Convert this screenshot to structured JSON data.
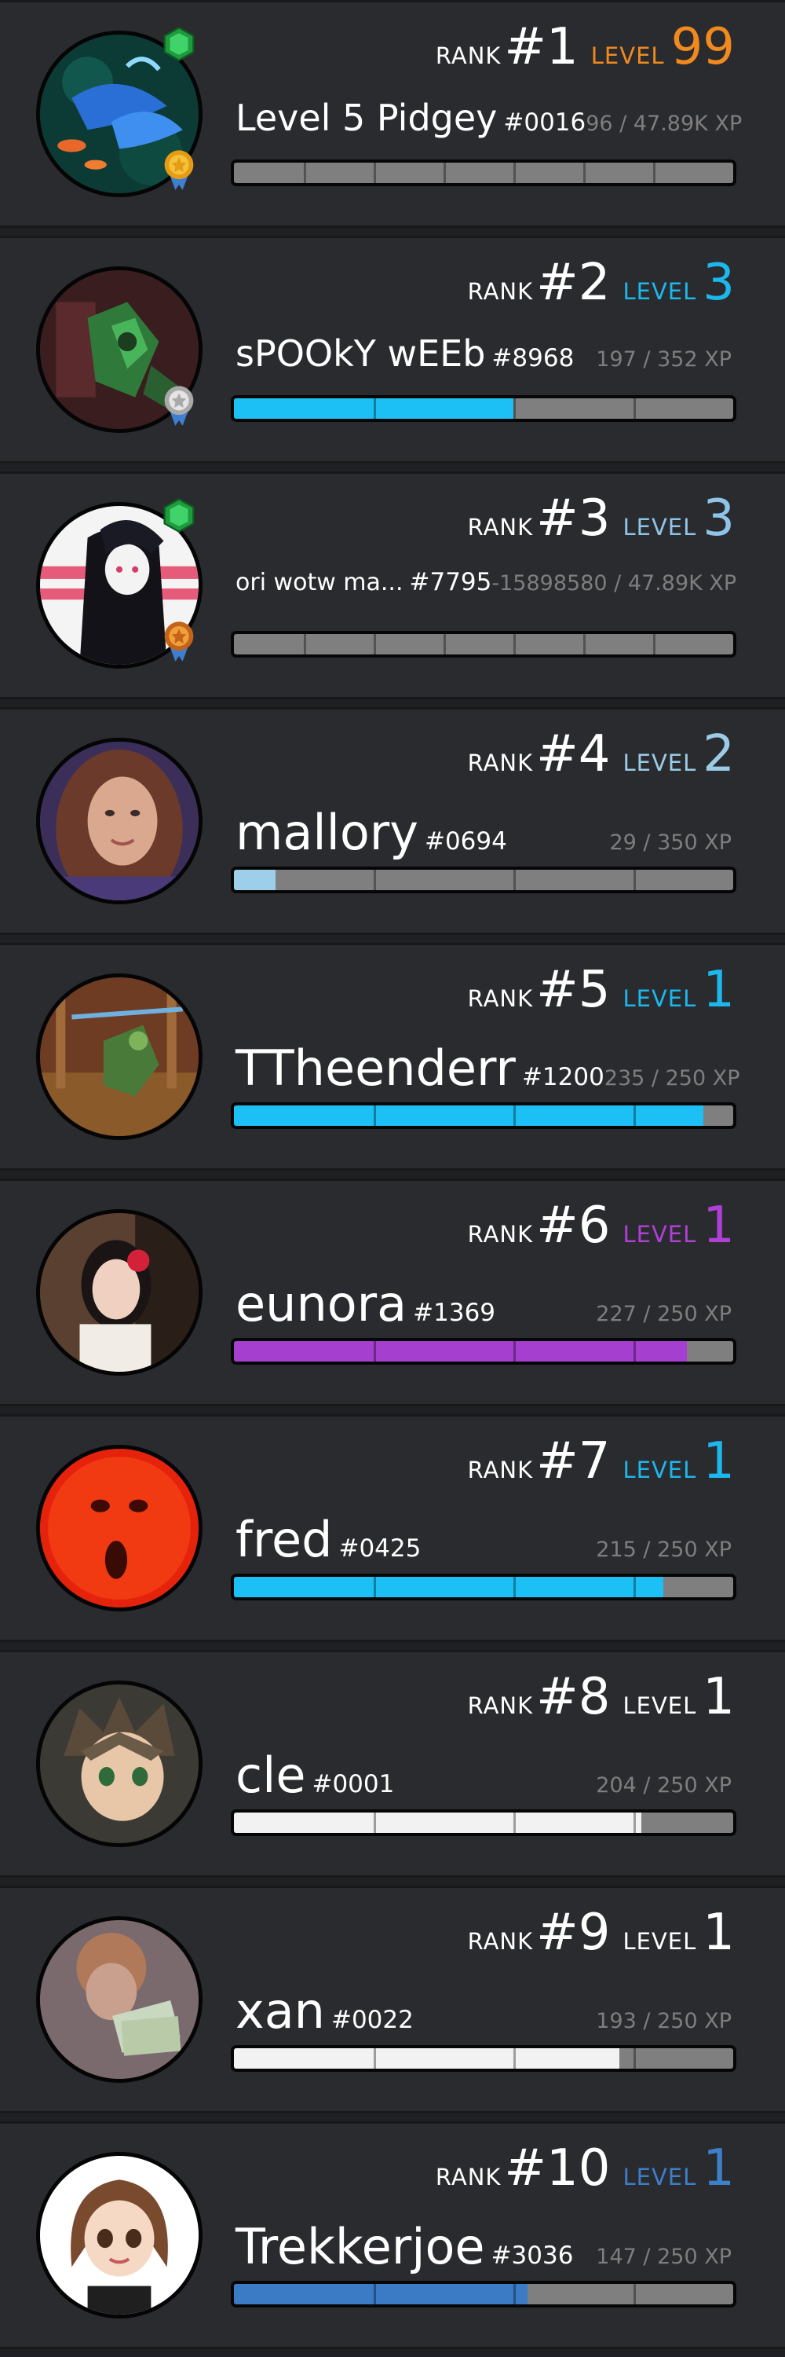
{
  "leaderboard": {
    "rank_label": "RANK",
    "level_label": "LEVEL",
    "entries": [
      {
        "rank": "#1",
        "level": "99",
        "level_color": "#f08a1e",
        "username": "Level 5 Pidgey",
        "discriminator": "#0016",
        "xp": "96 / 47.89K XP",
        "progress": 0.002,
        "bar_color": "#7f7f7f",
        "name_size": "large",
        "avatar": "koi-fish-avatar",
        "badges": [
          "green-gem-icon",
          "gold-medal-icon"
        ]
      },
      {
        "rank": "#2",
        "level": "3",
        "level_color": "#1cb7ec",
        "username": "sPOOkY wEEb",
        "discriminator": "#8968",
        "xp": "197 / 352 XP",
        "progress": 0.56,
        "bar_color": "#1cc0f5",
        "name_size": "large",
        "avatar": "green-robot-avatar",
        "badges": [
          "silver-medal-icon"
        ]
      },
      {
        "rank": "#3",
        "level": "3",
        "level_color": "#8fc4e8",
        "username": "ori wotw ma...",
        "discriminator": "#7795",
        "xp": "-15898580 / 47.89K XP",
        "progress": 0.0,
        "bar_color": "#7f7f7f",
        "name_size": "small",
        "avatar": "anime-girl-avatar",
        "badges": [
          "green-gem-icon",
          "bronze-medal-icon"
        ]
      },
      {
        "rank": "#4",
        "level": "2",
        "level_color": "#9bcbe6",
        "username": "mallory",
        "discriminator": "#0694",
        "xp": "29 / 350 XP",
        "progress": 0.083,
        "bar_color": "#9dcfea",
        "name_size": "xlarge",
        "avatar": "woman-photo-avatar",
        "badges": []
      },
      {
        "rank": "#5",
        "level": "1",
        "level_color": "#1cb7ec",
        "username": "TTheenderr",
        "discriminator": "#1200",
        "xp": "235 / 250 XP",
        "progress": 0.94,
        "bar_color": "#1cc0f5",
        "name_size": "xlarge",
        "avatar": "game-character-avatar",
        "badges": []
      },
      {
        "rank": "#6",
        "level": "1",
        "level_color": "#b03fd6",
        "username": "eunora",
        "discriminator": "#1369",
        "xp": "227 / 250 XP",
        "progress": 0.908,
        "bar_color": "#a43fd0",
        "name_size": "xlarge",
        "avatar": "woman-red-flower-avatar",
        "badges": []
      },
      {
        "rank": "#7",
        "level": "1",
        "level_color": "#1cb7ec",
        "username": "fred",
        "discriminator": "#0425",
        "xp": "215 / 250 XP",
        "progress": 0.86,
        "bar_color": "#1cc0f5",
        "name_size": "xlarge",
        "avatar": "red-face-avatar",
        "badges": []
      },
      {
        "rank": "#8",
        "level": "1",
        "level_color": "#ffffff",
        "username": "cle",
        "discriminator": "#0001",
        "xp": "204 / 250 XP",
        "progress": 0.816,
        "bar_color": "#f2f2f2",
        "name_size": "xlarge",
        "avatar": "anime-boy-avatar",
        "badges": []
      },
      {
        "rank": "#9",
        "level": "1",
        "level_color": "#ffffff",
        "username": "xan",
        "discriminator": "#0022",
        "xp": "193 / 250 XP",
        "progress": 0.772,
        "bar_color": "#f2f2f2",
        "name_size": "xlarge",
        "avatar": "money-photo-avatar",
        "badges": []
      },
      {
        "rank": "#10",
        "level": "1",
        "level_color": "#3d7fc9",
        "username": "Trekkerjoe",
        "discriminator": "#3036",
        "xp": "147 / 250 XP",
        "progress": 0.588,
        "bar_color": "#3b7bc6",
        "name_size": "xlarge",
        "avatar": "cartoon-girl-avatar",
        "badges": []
      }
    ]
  }
}
